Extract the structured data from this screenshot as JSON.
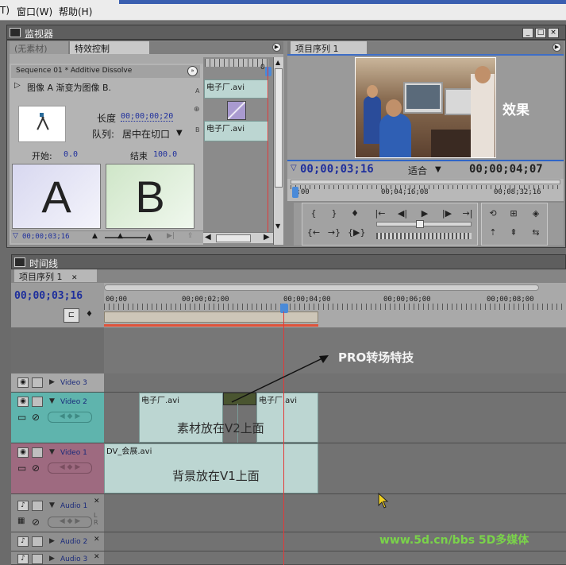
{
  "menubar": {
    "items": [
      "T)",
      "窗口(W)",
      "帮助(H)"
    ]
  },
  "monitor": {
    "window_title": "监视器",
    "tabs": [
      "(无素材)",
      "特效控制"
    ],
    "effect_control": {
      "sequence_label": "Sequence 01 * Additive Dissolve",
      "transition_desc": "图像 A 渐变为图像 B.",
      "duration_label": "长度",
      "duration_value": "00;00;00;20",
      "alignment_label": "队列:",
      "alignment_value": "居中在切口",
      "start_label": "开始:",
      "start_value": "0.0",
      "end_label": "结束",
      "end_value": "100.0",
      "card_a": "A",
      "card_b": "B",
      "side_a": "A",
      "side_b": "B",
      "ruler_top": "0",
      "clip_a_name": "电子厂.avi",
      "clip_b_name": "电子厂.avi",
      "timecode": "00;00;03;16"
    },
    "program": {
      "tab_label": "项目序列 1",
      "overlay_text": "效果",
      "current_timecode": "00;00;03;16",
      "zoom_label": "适合",
      "duration_timecode": "00;00;04;07",
      "ruler_labels": [
        "0;00",
        "00;04;16;08",
        "00;08;32;16"
      ]
    }
  },
  "timeline": {
    "window_title": "时间线",
    "tab_label": "项目序列 1",
    "current_timecode": "00;00;03;16",
    "ruler_labels": [
      "00;00",
      "00;00;02;00",
      "00;00;04;00",
      "00;00;06;00",
      "00;00;08;00"
    ],
    "tracks": {
      "video3": "Video 3",
      "video2": "Video 2",
      "video1": "Video 1",
      "audio1": "Audio 1",
      "audio2": "Audio 2",
      "audio3": "Audio 3"
    },
    "clips": {
      "v2_left": "电子厂.avi",
      "v2_right": "电子厂.avi",
      "v1": "DV_会展.avi"
    },
    "annotations": {
      "pro": "PRO转场特技",
      "v2_note": "素材放在V2上面",
      "v1_note": "背景放在V1上面",
      "audio_letters": "L R"
    }
  },
  "watermark": "www.5d.cn/bbs  5D多媒体",
  "colors": {
    "timecode": "#1e2f9c",
    "video2_head": "#5fb4ad",
    "video1_head": "#9e6a80",
    "clip_fill": "#bcd6d2",
    "playhead": "#e23a3a",
    "watermark": "#7ad34a"
  },
  "icons": [
    "monitor-window-icon",
    "timeline-window-icon",
    "eye-icon",
    "speaker-icon",
    "play-icon",
    "marker-icon",
    "cursor-icon"
  ]
}
